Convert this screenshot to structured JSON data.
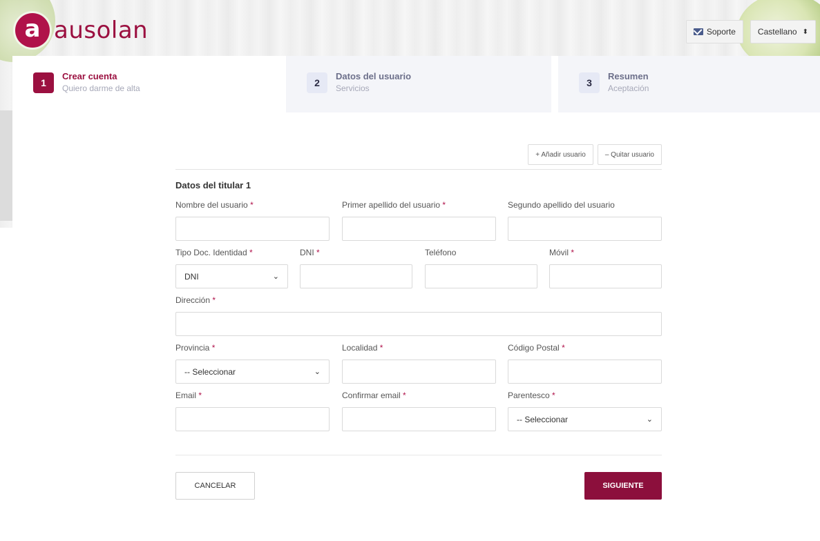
{
  "header": {
    "brand": "ausolan",
    "brand_mark": "a",
    "support_label": "Soporte",
    "language_label": "Castellano",
    "brand_color": "#9b1040"
  },
  "steps": [
    {
      "number": "1",
      "title": "Crear cuenta",
      "subtitle": "Quiero darme de alta",
      "active": true
    },
    {
      "number": "2",
      "title": "Datos del usuario",
      "subtitle": "Servicios",
      "active": false
    },
    {
      "number": "3",
      "title": "Resumen",
      "subtitle": "Aceptación",
      "active": false
    }
  ],
  "user_actions": {
    "add_label": "+ Añadir usuario",
    "remove_label": "– Quitar usuario"
  },
  "form": {
    "section_title": "Datos del titular 1",
    "required_mark": "*",
    "fields": {
      "nombre": {
        "label": "Nombre del usuario",
        "value": ""
      },
      "apellido1": {
        "label": "Primer apellido del usuario",
        "value": ""
      },
      "apellido2": {
        "label": "Segundo apellido del usuario",
        "value": ""
      },
      "tipo_doc": {
        "label": "Tipo Doc. Identidad",
        "value": "DNI"
      },
      "dni": {
        "label": "DNI",
        "value": ""
      },
      "telefono": {
        "label": "Teléfono",
        "value": ""
      },
      "movil": {
        "label": "Móvil",
        "value": ""
      },
      "direccion": {
        "label": "Dirección",
        "value": ""
      },
      "provincia": {
        "label": "Provincia",
        "value": "-- Seleccionar"
      },
      "localidad": {
        "label": "Localidad",
        "value": ""
      },
      "codigo_postal": {
        "label": "Código Postal",
        "value": ""
      },
      "email": {
        "label": "Email",
        "value": ""
      },
      "confirmar_email": {
        "label": "Confirmar email",
        "value": ""
      },
      "parentesco": {
        "label": "Parentesco",
        "value": "-- Seleccionar"
      }
    }
  },
  "footer": {
    "cancel_label": "CANCELAR",
    "next_label": "SIGUIENTE"
  },
  "icons": {
    "mail": "mail-icon",
    "language_toggle": "updown-icon",
    "select_chevron": "chevron-down-icon"
  }
}
